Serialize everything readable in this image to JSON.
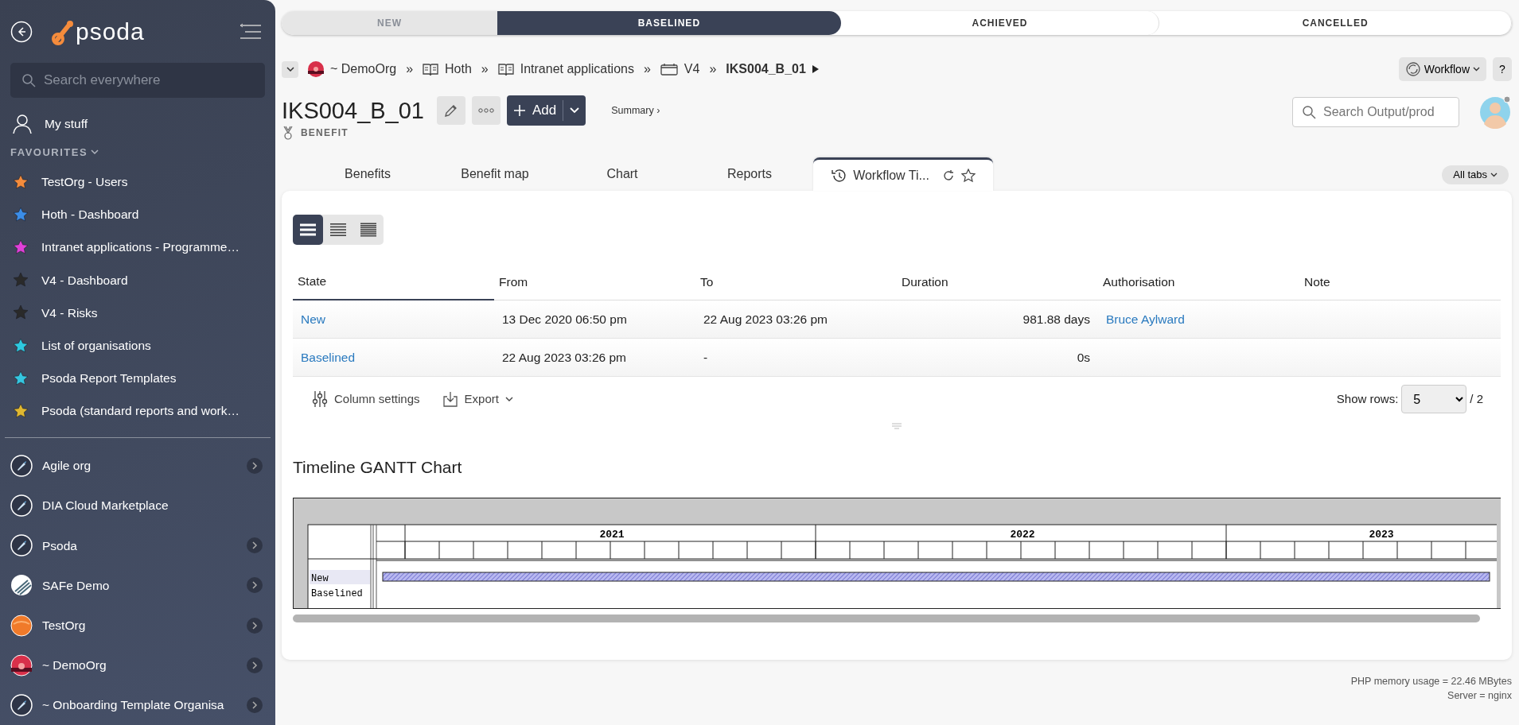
{
  "sidebar": {
    "logo": "psoda",
    "search": {
      "placeholder": "Search everywhere"
    },
    "my_stuff": "My stuff",
    "favourites_heading": "FAVOURITES",
    "favourites": [
      {
        "label": "TestOrg - Users",
        "color": "#f58c3c"
      },
      {
        "label": "Hoth - Dashboard",
        "color": "#3b8de8"
      },
      {
        "label": "Intranet applications - Programme…",
        "color": "#e040d8"
      },
      {
        "label": "V4 - Dashboard",
        "color": "#2a2a2a"
      },
      {
        "label": "V4 - Risks",
        "color": "#2a2a2a"
      },
      {
        "label": "List of organisations",
        "color": "#2ec9e0"
      },
      {
        "label": "Psoda Report Templates",
        "color": "#35c6e0"
      },
      {
        "label": "Psoda (standard reports and work…",
        "color": "#e0b830"
      }
    ],
    "organisations": [
      {
        "label": "Agile org",
        "kind": "rocket",
        "expandable": true
      },
      {
        "label": "DIA Cloud Marketplace",
        "kind": "rocket",
        "expandable": false
      },
      {
        "label": "Psoda",
        "kind": "rocket",
        "expandable": true
      },
      {
        "label": "SAFe Demo",
        "kind": "stripes",
        "expandable": true
      },
      {
        "label": "TestOrg",
        "kind": "orange",
        "expandable": true
      },
      {
        "label": "~ DemoOrg",
        "kind": "sunset",
        "expandable": true
      },
      {
        "label": "~ Onboarding Template Organisa",
        "kind": "rocket",
        "expandable": true
      }
    ]
  },
  "stages": [
    {
      "label": "NEW",
      "kind": "done"
    },
    {
      "label": "BASELINED",
      "kind": "current"
    },
    {
      "label": "ACHIEVED",
      "kind": "todo"
    },
    {
      "label": "CANCELLED",
      "kind": "todo"
    }
  ],
  "breadcrumb": [
    {
      "label": "~ DemoOrg",
      "kind": "org"
    },
    {
      "label": "Hoth",
      "kind": "book",
      "separator": "»"
    },
    {
      "label": "Intranet applications",
      "kind": "book",
      "separator": "»"
    },
    {
      "label": "V4",
      "kind": "calendar",
      "separator": "»"
    },
    {
      "label": "IKS004_B_01",
      "kind": "current",
      "separator": "»"
    }
  ],
  "workflow_button": "Workflow",
  "help_button": "?",
  "title": "IKS004_B_01",
  "item_type": "BENEFIT",
  "add_button": "Add",
  "summary_link": "Summary ›",
  "search": {
    "placeholder": "Search Output/prod"
  },
  "tabs": [
    {
      "label": "Benefits",
      "selected": false
    },
    {
      "label": "Benefit map",
      "selected": false
    },
    {
      "label": "Chart",
      "selected": false
    },
    {
      "label": "Reports",
      "selected": false
    },
    {
      "label": "Workflow Ti...",
      "selected": true
    }
  ],
  "all_tabs": "All tabs",
  "density": [
    {
      "kind": "normal",
      "selected": true
    },
    {
      "kind": "compact",
      "selected": false
    },
    {
      "kind": "dense",
      "selected": false
    }
  ],
  "table": {
    "columns": [
      {
        "label": "State",
        "sorted": true
      },
      {
        "label": "From",
        "sorted": false
      },
      {
        "label": "To",
        "sorted": false
      },
      {
        "label": "Duration",
        "sorted": false
      },
      {
        "label": "Authorisation",
        "sorted": false
      },
      {
        "label": "Note",
        "sorted": false
      }
    ],
    "rows": [
      {
        "state": "New",
        "from": "13 Dec 2020 06:50 pm",
        "to": "22 Aug 2023 03:26 pm",
        "duration": "981.88 days",
        "authorisation": "Bruce Aylward"
      },
      {
        "state": "Baselined",
        "from": "22 Aug 2023 03:26 pm",
        "to": "-",
        "duration": "0s"
      }
    ]
  },
  "table_footer": {
    "column_settings": "Column settings",
    "export": "Export",
    "show_rows_label": "Show rows:",
    "show_rows": "5",
    "pages": "/ 2"
  },
  "gantt": {
    "title": "Timeline GANTT Chart",
    "years": [
      "2021",
      "2022",
      "2023"
    ],
    "rows": [
      {
        "label": "New",
        "highlighted": true,
        "bar": true
      },
      {
        "label": "Baselined",
        "highlighted": false,
        "bar": false
      }
    ]
  },
  "footer": [
    "PHP memory usage = 22.46 MBytes",
    "Server = nginx"
  ]
}
